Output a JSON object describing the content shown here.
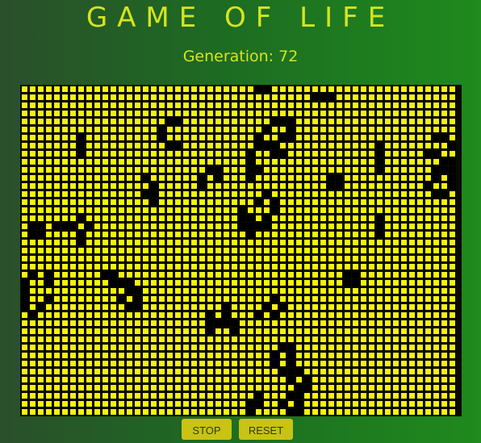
{
  "title": "GAME OF LIFE",
  "generation_label": "Generation: 72",
  "buttons": {
    "stop": "STOP",
    "reset": "RESET"
  },
  "colors": {
    "alive": "#000000",
    "dead": "#f4f40f",
    "text": "#d6e41e",
    "button": "#c9c313"
  },
  "grid": {
    "cols": 54,
    "rows": 41,
    "alive": [
      [
        29,
        0
      ],
      [
        30,
        0
      ],
      [
        36,
        1
      ],
      [
        37,
        1
      ],
      [
        38,
        1
      ],
      [
        18,
        4
      ],
      [
        19,
        4
      ],
      [
        31,
        4
      ],
      [
        32,
        4
      ],
      [
        33,
        4
      ],
      [
        17,
        5
      ],
      [
        30,
        5
      ],
      [
        33,
        5
      ],
      [
        7,
        6
      ],
      [
        17,
        6
      ],
      [
        29,
        6
      ],
      [
        32,
        6
      ],
      [
        33,
        6
      ],
      [
        51,
        6
      ],
      [
        52,
        6
      ],
      [
        7,
        7
      ],
      [
        18,
        7
      ],
      [
        19,
        7
      ],
      [
        29,
        7
      ],
      [
        30,
        7
      ],
      [
        31,
        7
      ],
      [
        44,
        7
      ],
      [
        53,
        7
      ],
      [
        7,
        8
      ],
      [
        28,
        8
      ],
      [
        31,
        8
      ],
      [
        32,
        8
      ],
      [
        44,
        8
      ],
      [
        50,
        8
      ],
      [
        51,
        8
      ],
      [
        28,
        9
      ],
      [
        44,
        9
      ],
      [
        52,
        9
      ],
      [
        53,
        9
      ],
      [
        23,
        10
      ],
      [
        24,
        10
      ],
      [
        28,
        10
      ],
      [
        29,
        10
      ],
      [
        44,
        10
      ],
      [
        51,
        10
      ],
      [
        52,
        10
      ],
      [
        53,
        10
      ],
      [
        15,
        11
      ],
      [
        22,
        11
      ],
      [
        24,
        11
      ],
      [
        28,
        11
      ],
      [
        38,
        11
      ],
      [
        39,
        11
      ],
      [
        51,
        11
      ],
      [
        53,
        11
      ],
      [
        16,
        12
      ],
      [
        22,
        12
      ],
      [
        38,
        12
      ],
      [
        39,
        12
      ],
      [
        50,
        12
      ],
      [
        53,
        12
      ],
      [
        15,
        13
      ],
      [
        16,
        13
      ],
      [
        30,
        13
      ],
      [
        51,
        13
      ],
      [
        52,
        13
      ],
      [
        16,
        14
      ],
      [
        29,
        14
      ],
      [
        31,
        14
      ],
      [
        27,
        15
      ],
      [
        31,
        15
      ],
      [
        7,
        16
      ],
      [
        27,
        16
      ],
      [
        28,
        16
      ],
      [
        30,
        16
      ],
      [
        44,
        16
      ],
      [
        1,
        17
      ],
      [
        2,
        17
      ],
      [
        4,
        17
      ],
      [
        5,
        17
      ],
      [
        6,
        17
      ],
      [
        8,
        17
      ],
      [
        27,
        17
      ],
      [
        28,
        17
      ],
      [
        29,
        17
      ],
      [
        30,
        17
      ],
      [
        44,
        17
      ],
      [
        1,
        18
      ],
      [
        2,
        18
      ],
      [
        7,
        18
      ],
      [
        28,
        18
      ],
      [
        44,
        18
      ],
      [
        7,
        19
      ],
      [
        1,
        23
      ],
      [
        3,
        23
      ],
      [
        10,
        23
      ],
      [
        11,
        23
      ],
      [
        40,
        23
      ],
      [
        41,
        23
      ],
      [
        0,
        24
      ],
      [
        3,
        24
      ],
      [
        11,
        24
      ],
      [
        12,
        24
      ],
      [
        13,
        24
      ],
      [
        40,
        24
      ],
      [
        41,
        24
      ],
      [
        0,
        25
      ],
      [
        13,
        25
      ],
      [
        14,
        25
      ],
      [
        0,
        26
      ],
      [
        3,
        26
      ],
      [
        12,
        26
      ],
      [
        14,
        26
      ],
      [
        31,
        26
      ],
      [
        0,
        27
      ],
      [
        2,
        27
      ],
      [
        13,
        27
      ],
      [
        14,
        27
      ],
      [
        25,
        27
      ],
      [
        30,
        27
      ],
      [
        32,
        27
      ],
      [
        1,
        28
      ],
      [
        23,
        28
      ],
      [
        25,
        28
      ],
      [
        29,
        28
      ],
      [
        31,
        28
      ],
      [
        23,
        29
      ],
      [
        24,
        29
      ],
      [
        25,
        29
      ],
      [
        26,
        29
      ],
      [
        23,
        30
      ],
      [
        26,
        30
      ],
      [
        32,
        32
      ],
      [
        33,
        32
      ],
      [
        31,
        33
      ],
      [
        33,
        33
      ],
      [
        31,
        34
      ],
      [
        33,
        34
      ],
      [
        32,
        35
      ],
      [
        33,
        35
      ],
      [
        34,
        35
      ],
      [
        33,
        36
      ],
      [
        35,
        36
      ],
      [
        34,
        37
      ],
      [
        35,
        37
      ],
      [
        29,
        38
      ],
      [
        33,
        38
      ],
      [
        34,
        38
      ],
      [
        28,
        39
      ],
      [
        29,
        39
      ],
      [
        32,
        39
      ],
      [
        34,
        39
      ],
      [
        28,
        40
      ],
      [
        33,
        40
      ],
      [
        34,
        40
      ]
    ]
  }
}
